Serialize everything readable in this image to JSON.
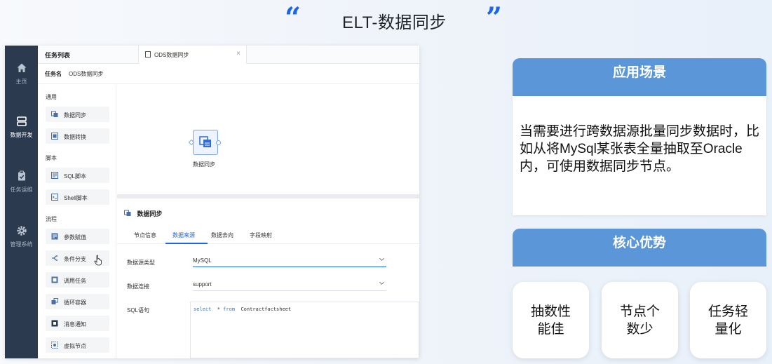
{
  "page": {
    "title": "ELT-数据同步",
    "quote_open": "“",
    "quote_close": "”"
  },
  "nav": {
    "items": [
      {
        "label": "主页",
        "icon": "home-icon"
      },
      {
        "label": "数据开发",
        "icon": "server-icon",
        "active": true
      },
      {
        "label": "任务运维",
        "icon": "clipboard-icon"
      },
      {
        "label": "管理系统",
        "icon": "gear-icon"
      }
    ]
  },
  "task_header": {
    "list_title": "任务列表",
    "open_tab": "ODS数据同步",
    "close_glyph": "×"
  },
  "task_name": {
    "label": "任务名",
    "value": "ODS数据同步"
  },
  "palette": {
    "categories": {
      "general": "通用",
      "script": "脚本",
      "flow": "流程"
    },
    "general_items": [
      "数据同步",
      "数据转换"
    ],
    "script_items": [
      "SQL脚本",
      "Shell脚本"
    ],
    "flow_items": [
      "参数赋值",
      "条件分支",
      "调用任务",
      "循环容器",
      "消息通知",
      "虚拟节点"
    ]
  },
  "canvas": {
    "node_label": "数据同步"
  },
  "panel": {
    "title": "数据同步",
    "tabs": [
      "节点信息",
      "数据来源",
      "数据去向",
      "字段映射"
    ],
    "active_tab": "数据来源",
    "fields": {
      "source_type_label": "数据源类型",
      "source_type_value": "MySQL",
      "connection_label": "数据连接",
      "connection_value": "support",
      "sql_label": "SQL语句",
      "sql_kw_select": "select",
      "sql_star": "*",
      "sql_kw_from": "from",
      "sql_table": "Contractfactsheet"
    }
  },
  "scenario": {
    "heading": "应用场景",
    "body": "当需要进行跨数据源批量同步数据时，比如从将MySql某张表全量抽取至Oracle内，可使用数据同步节点。"
  },
  "advantages": {
    "heading": "核心优势",
    "items": [
      {
        "line1": "抽数性",
        "line2": "能佳"
      },
      {
        "line1": "节点个",
        "line2": "数少"
      },
      {
        "line1": "任务轻",
        "line2": "量化"
      }
    ]
  },
  "colors": {
    "accent": "#1a66e6",
    "nav_bg": "#2c3a50",
    "card_head": "#5b96d8"
  }
}
